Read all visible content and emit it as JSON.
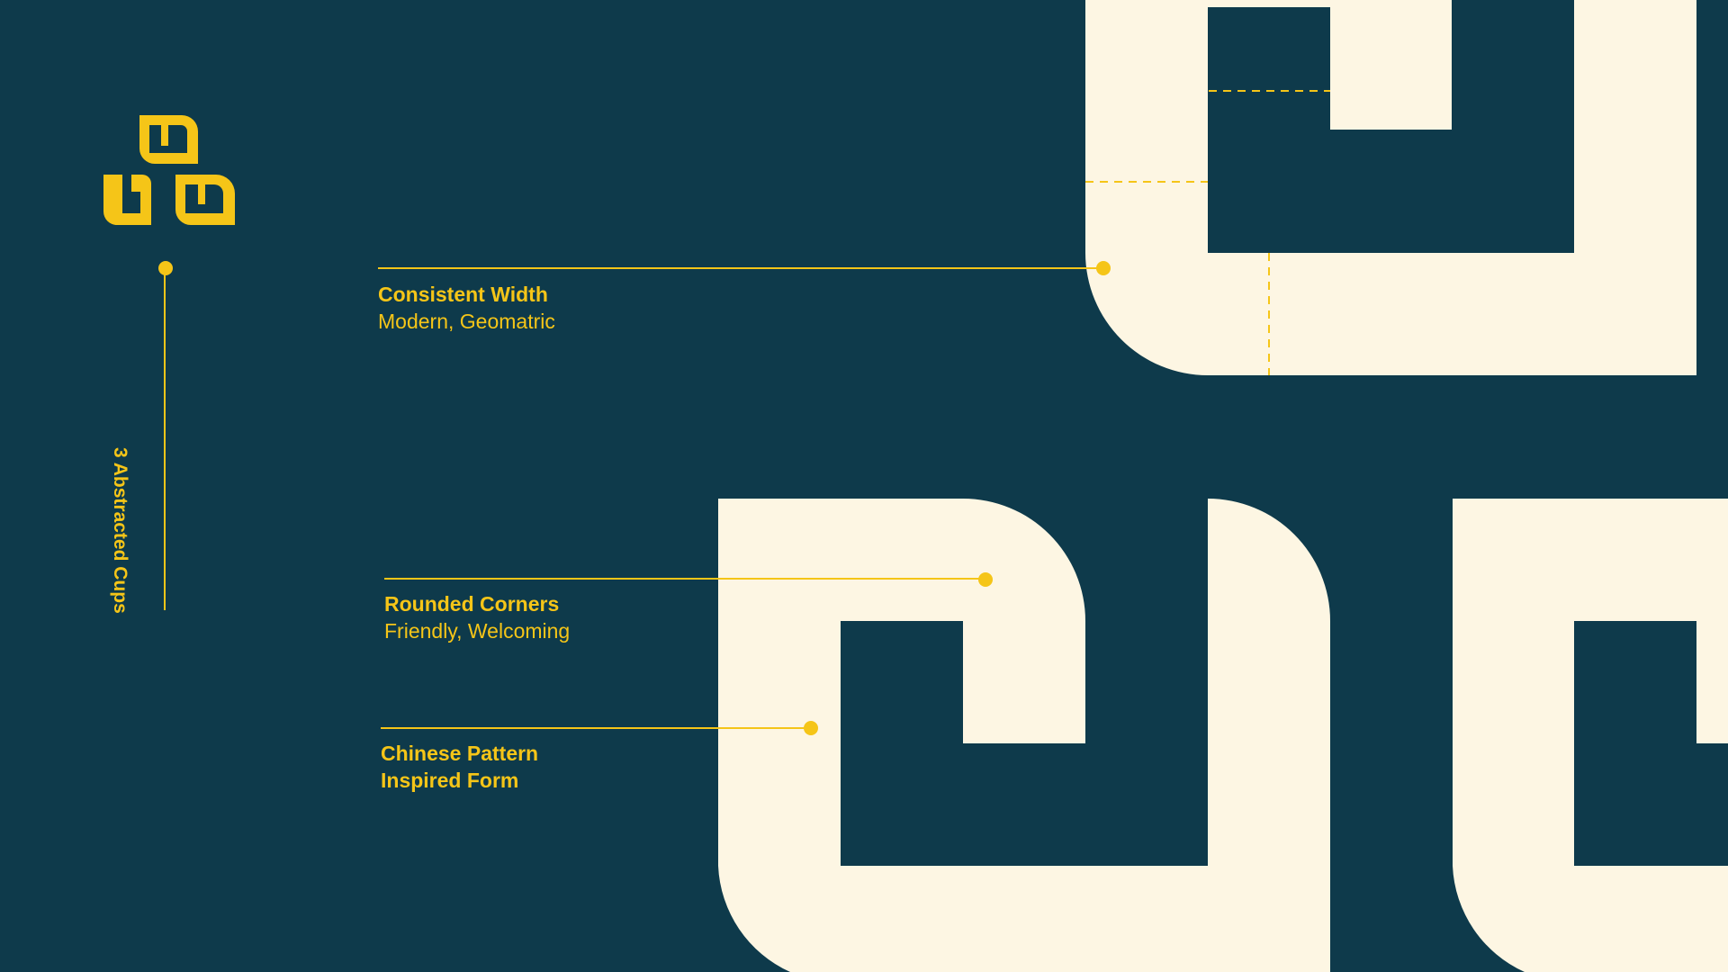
{
  "colors": {
    "background": "#0e3a4b",
    "cream": "#fdf6e3",
    "accent": "#f5c518"
  },
  "logo": {
    "icon": "three-cups-logo-icon"
  },
  "side_label": "3 Abstracted Cups",
  "callouts": [
    {
      "title": "Consistent Width",
      "subtitle": "Modern, Geomatric"
    },
    {
      "title": "Rounded Corners",
      "subtitle": "Friendly, Welcoming"
    },
    {
      "title": "Chinese Pattern",
      "subtitle": "Inspired Form"
    }
  ]
}
